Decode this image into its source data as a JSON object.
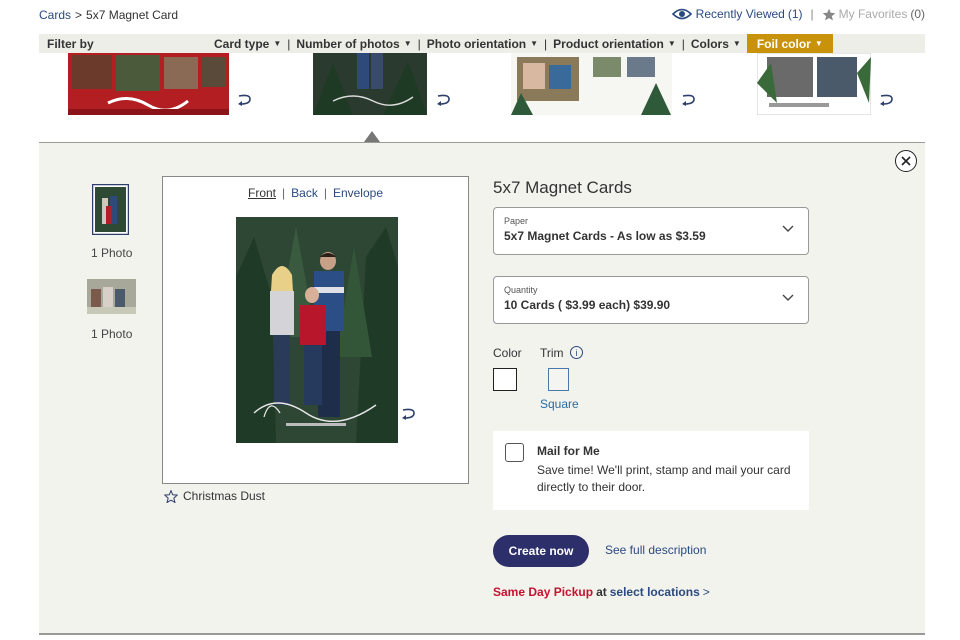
{
  "breadcrumb": {
    "root": "Cards",
    "sep": ">",
    "current": "5x7 Magnet Card"
  },
  "header": {
    "recently_viewed": "Recently Viewed",
    "recently_viewed_count": "(1)",
    "separator": "|",
    "favorites": "My Favorites",
    "favorites_count": "(0)"
  },
  "filters": {
    "label": "Filter by",
    "items": [
      "Card type",
      "Number of photos",
      "Photo orientation",
      "Product orientation",
      "Colors"
    ],
    "foil": "Foil color",
    "sep": "|"
  },
  "preview": {
    "views": [
      "Front",
      "Back",
      "Envelope"
    ],
    "view_sep": "|",
    "design_name": "Christmas Dust"
  },
  "side_thumbs": [
    {
      "label": "1 Photo"
    },
    {
      "label": "1 Photo"
    }
  ],
  "product": {
    "title": "5x7 Magnet Cards",
    "paper_label": "Paper",
    "paper_value": "5x7 Magnet Cards - As low as $3.59",
    "quantity_label": "Quantity",
    "quantity_value": "10 Cards ( $3.99 each) $39.90",
    "color_label": "Color",
    "trim_label": "Trim",
    "trim_value": "Square",
    "mail_title": "Mail for Me",
    "mail_desc": "Save time! We'll print, stamp and mail your card directly to their door.",
    "create_button": "Create now",
    "full_description": "See full description",
    "pickup_red": "Same Day Pickup",
    "pickup_at": "at",
    "pickup_link": "select locations",
    "pickup_gt": ">"
  },
  "colors": {
    "link": "#2a4a80",
    "foil": "#c8920a",
    "button": "#2d2f6b",
    "pickup_red": "#c4122f",
    "panel_bg": "#f3f3ee"
  }
}
